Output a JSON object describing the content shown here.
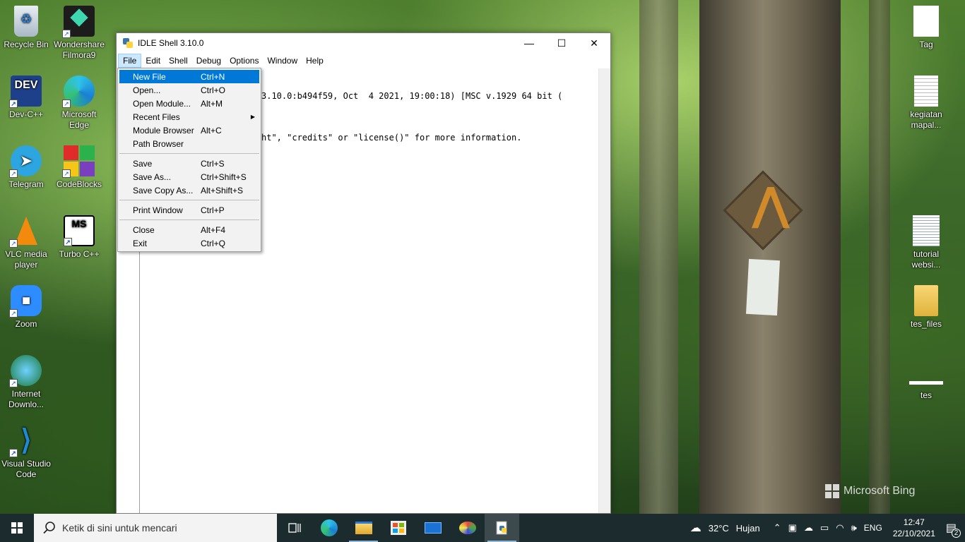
{
  "desktop": {
    "left_icons": [
      {
        "label": "Recycle Bin",
        "icon": "recycle-bin-icon"
      },
      {
        "label": "Wondershare Filmora9",
        "icon": "filmora-icon"
      },
      {
        "label": "Dev-C++",
        "icon": "devcpp-icon"
      },
      {
        "label": "Microsoft Edge",
        "icon": "edge-icon"
      },
      {
        "label": "Telegram",
        "icon": "telegram-icon"
      },
      {
        "label": "CodeBlocks",
        "icon": "codeblocks-icon"
      },
      {
        "label": "VLC media player",
        "icon": "vlc-icon"
      },
      {
        "label": "Turbo C++",
        "icon": "turbocpp-icon"
      },
      {
        "label": "Zoom",
        "icon": "zoom-icon"
      },
      {
        "label": "Internet Downlo...",
        "icon": "idm-icon"
      },
      {
        "label": "Visual Studio Code",
        "icon": "vscode-icon"
      }
    ],
    "right_icons": [
      {
        "label": "Tag",
        "icon": "file-icon"
      },
      {
        "label": "kegiatan mapal...",
        "icon": "document-icon"
      },
      {
        "label": "tutorial websi...",
        "icon": "document-icon"
      },
      {
        "label": "tes_files",
        "icon": "folder-icon"
      },
      {
        "label": "tes",
        "icon": "file-icon"
      }
    ],
    "watermark": "Microsoft Bing"
  },
  "window": {
    "title": "IDLE Shell 3.10.0",
    "menu": [
      "File",
      "Edit",
      "Shell",
      "Debug",
      "Options",
      "Window",
      "Help"
    ],
    "active_menu": "File",
    "lines": [
      "3.10.0:b494f59, Oct  4 2021, 19:00:18) [MSC v.1929 64 bit (",
      "ht\", \"credits\" or \"license()\" for more information."
    ]
  },
  "file_menu": {
    "groups": [
      [
        {
          "label": "New File",
          "shortcut": "Ctrl+N",
          "highlighted": true
        },
        {
          "label": "Open...",
          "shortcut": "Ctrl+O"
        },
        {
          "label": "Open Module...",
          "shortcut": "Alt+M"
        },
        {
          "label": "Recent Files",
          "shortcut": "",
          "submenu": true
        },
        {
          "label": "Module Browser",
          "shortcut": "Alt+C"
        },
        {
          "label": "Path Browser",
          "shortcut": ""
        }
      ],
      [
        {
          "label": "Save",
          "shortcut": "Ctrl+S"
        },
        {
          "label": "Save As...",
          "shortcut": "Ctrl+Shift+S"
        },
        {
          "label": "Save Copy As...",
          "shortcut": "Alt+Shift+S"
        }
      ],
      [
        {
          "label": "Print Window",
          "shortcut": "Ctrl+P"
        }
      ],
      [
        {
          "label": "Close",
          "shortcut": "Alt+F4"
        },
        {
          "label": "Exit",
          "shortcut": "Ctrl+Q"
        }
      ]
    ]
  },
  "taskbar": {
    "search_placeholder": "Ketik di sini untuk mencari",
    "apps": [
      "task-view-icon",
      "edge-icon",
      "file-explorer-icon",
      "store-icon",
      "mail-icon",
      "paint-icon",
      "idle-icon"
    ],
    "weather_temp": "32°C",
    "weather_text": "Hujan",
    "language": "ENG",
    "time": "12:47",
    "date": "22/10/2021",
    "notification_count": "2"
  }
}
